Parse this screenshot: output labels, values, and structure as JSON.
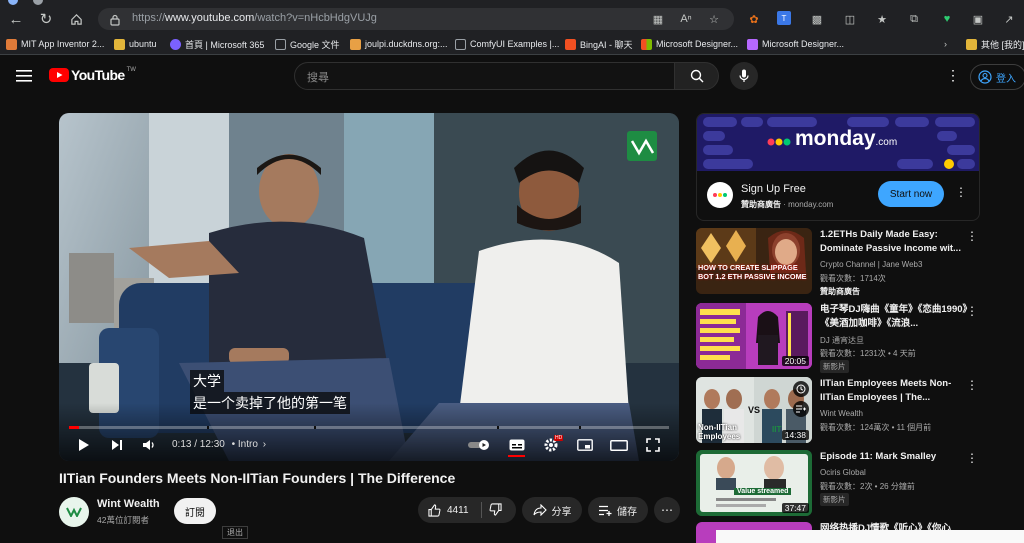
{
  "browser": {
    "url_prefix": "https://",
    "url_host": "www.youtube.com",
    "url_path": "/watch?v=nHcbHdgVUJg",
    "bookmarks": [
      {
        "label": "MIT App Inventor 2...",
        "color": "#e07b39"
      },
      {
        "label": "ubuntu",
        "color": "#e2b53a"
      },
      {
        "label": "首頁 | Microsoft 365",
        "color": "#7b61ff"
      },
      {
        "label": "Google 文件",
        "color": "#9aa0a6"
      },
      {
        "label": "joulpi.duckdns.org:...",
        "color": "#e8a045"
      },
      {
        "label": "ComfyUI Examples |...",
        "color": "#9aa0a6"
      },
      {
        "label": "BingAI - 聊天",
        "color": "#f25022"
      },
      {
        "label": "Microsoft Designer...",
        "color": "#00a4ef"
      },
      {
        "label": "Microsoft Designer...",
        "color": "#b668ff"
      }
    ],
    "other_bookmarks": "其他 [我的]"
  },
  "youtube": {
    "logo": "YouTube",
    "region": "TW",
    "search_placeholder": "搜尋",
    "signin": "登入"
  },
  "player": {
    "subtitle_line1": "大学",
    "subtitle_line2": "是一个卖掉了他的第一笔",
    "time": "0:13 / 12:30",
    "chapter": "• Intro",
    "progress": 0.017
  },
  "video": {
    "title": "IITian Founders Meets Non-IITian Founders | The Difference",
    "channel": "Wint Wealth",
    "subscribers": "42萬位訂閱者",
    "subscribe": "訂閱",
    "likes": "4411",
    "share": "分享",
    "save": "儲存",
    "partial_text": "退出"
  },
  "ad": {
    "brand": "monday",
    "brand_suffix": ".com",
    "headline": "Sign Up Free",
    "sponsor": "贊助商廣告",
    "domain": "· monday.com",
    "cta": "Start now"
  },
  "recommendations": [
    {
      "title": "1.2ETHs Daily Made Easy: Dominate Passive Income wit...",
      "channel": "Crypto Channel | Jane Web3",
      "meta": "觀看次數：1714次",
      "badge": "贊助商廣告",
      "thumb_text": "HOW TO CREATE SLIPPAGE BOT 1.2 ETH PASSIVE INCOME",
      "duration": ""
    },
    {
      "title": "电子琴DJ嗨曲《童年》《恋曲1990》《美酒加咖啡》《流浪...",
      "channel": "DJ 通宵达旦",
      "meta": "觀看次數：1231次 • 4 天前",
      "badge": "新影片",
      "thumb_text": "",
      "duration": "20:05"
    },
    {
      "title": "IITian Employees Meets Non-IITian Employees | The...",
      "channel": "Wint Wealth",
      "meta": "觀看次數：124萬次 • 11 個月前",
      "badge": "",
      "thumb_text": "Non-IITian Employees",
      "duration": "14:38"
    },
    {
      "title": "Episode 11: Mark Smalley",
      "channel": "Ociris Global",
      "meta": "觀看次數：2次 • 26 分鐘前",
      "badge": "新影片",
      "thumb_text": "Value streamed",
      "duration": "37:47"
    },
    {
      "title": "网络热播DJ情歌《听心》《你心",
      "channel": "",
      "meta": "",
      "badge": "",
      "thumb_text": "",
      "duration": ""
    }
  ]
}
